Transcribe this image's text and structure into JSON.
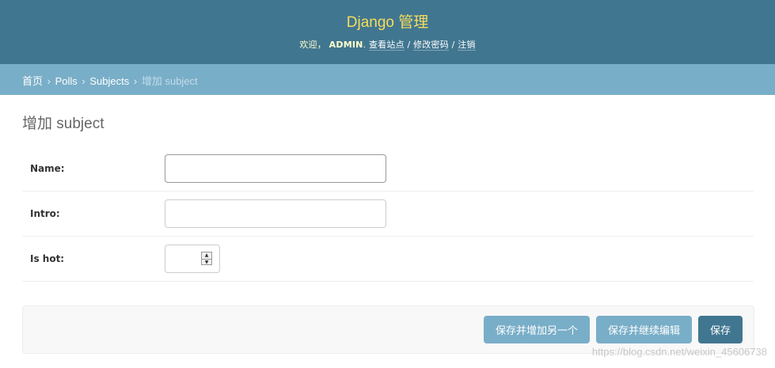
{
  "header": {
    "site_title": "Django 管理",
    "welcome": "欢迎，",
    "username": "ADMIN",
    "username_suffix": ".",
    "view_site": "查看站点",
    "change_password": "修改密码",
    "logout": "注销",
    "separator": "/"
  },
  "breadcrumbs": {
    "home": "首页",
    "app": "Polls",
    "model": "Subjects",
    "current": "增加 subject",
    "arrow": "›"
  },
  "page": {
    "title": "增加 subject"
  },
  "form": {
    "name_label": "Name:",
    "name_value": "",
    "intro_label": "Intro:",
    "intro_value": "",
    "is_hot_label": "Is hot:",
    "is_hot_value": "",
    "spinner_up": "▲",
    "spinner_down": "▼"
  },
  "submit": {
    "save_add_another": "保存并增加另一个",
    "save_continue": "保存并继续编辑",
    "save": "保存"
  },
  "watermark": "https://blog.csdn.net/weixin_45606738",
  "colors": {
    "header_bg": "#417690",
    "title_color": "#f5dd5d",
    "breadcrumbs_bg": "#79aec8",
    "primary_button": "#417690",
    "secondary_button": "#79aec8"
  }
}
